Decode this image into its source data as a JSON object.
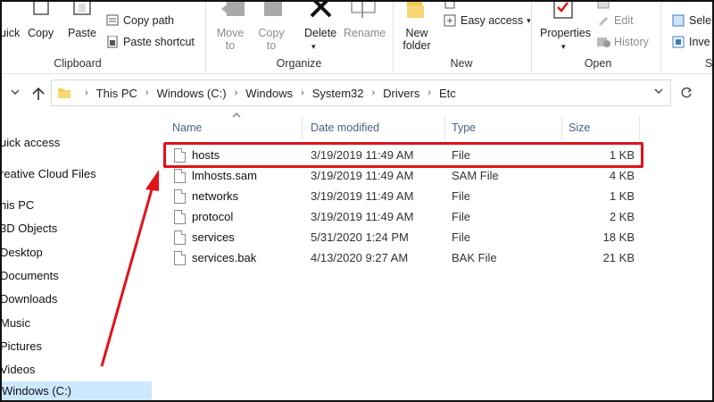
{
  "ribbon": {
    "clipboard": {
      "quick_access_label": "uick",
      "copy_label": "Copy",
      "paste_label": "Paste",
      "copy_path_label": "Copy path",
      "paste_shortcut_label": "Paste shortcut",
      "group_label": "Clipboard"
    },
    "organize": {
      "move_to_label": "Move\nto",
      "copy_to_label": "Copy\nto",
      "delete_label": "Delete",
      "rename_label": "Rename",
      "group_label": "Organize"
    },
    "new": {
      "new_folder_label": "New\nfolder",
      "easy_access_label": "Easy access",
      "group_label": "New"
    },
    "open": {
      "properties_label": "Properties",
      "edit_label": "Edit",
      "history_label": "History",
      "group_label": "Open"
    },
    "select": {
      "select_label": "Sele",
      "invert_label": "Inve"
    }
  },
  "address": {
    "crumbs": [
      "This PC",
      "Windows (C:)",
      "Windows",
      "System32",
      "Drivers",
      "Etc"
    ]
  },
  "navpane": {
    "items": [
      {
        "label": "uick access"
      },
      {
        "label": "reative Cloud Files"
      },
      {
        "label": "his PC"
      },
      {
        "label": "3D Objects"
      },
      {
        "label": "Desktop"
      },
      {
        "label": "Documents"
      },
      {
        "label": "Downloads"
      },
      {
        "label": "Music"
      },
      {
        "label": "Pictures"
      },
      {
        "label": "Videos"
      },
      {
        "label": "Windows (C:)"
      }
    ]
  },
  "list": {
    "columns": {
      "name": "Name",
      "date": "Date modified",
      "type": "Type",
      "size": "Size"
    },
    "rows": [
      {
        "name": "hosts",
        "date": "3/19/2019 11:49 AM",
        "type": "File",
        "size": "1 KB"
      },
      {
        "name": "lmhosts.sam",
        "date": "3/19/2019 11:49 AM",
        "type": "SAM File",
        "size": "4 KB"
      },
      {
        "name": "networks",
        "date": "3/19/2019 11:49 AM",
        "type": "File",
        "size": "1 KB"
      },
      {
        "name": "protocol",
        "date": "3/19/2019 11:49 AM",
        "type": "File",
        "size": "2 KB"
      },
      {
        "name": "services",
        "date": "5/31/2020 1:24 PM",
        "type": "File",
        "size": "18 KB"
      },
      {
        "name": "services.bak",
        "date": "4/13/2020 9:27 AM",
        "type": "BAK File",
        "size": "21 KB"
      }
    ]
  },
  "annotation": {
    "color": "#e0121b",
    "highlighted_item": "hosts"
  }
}
